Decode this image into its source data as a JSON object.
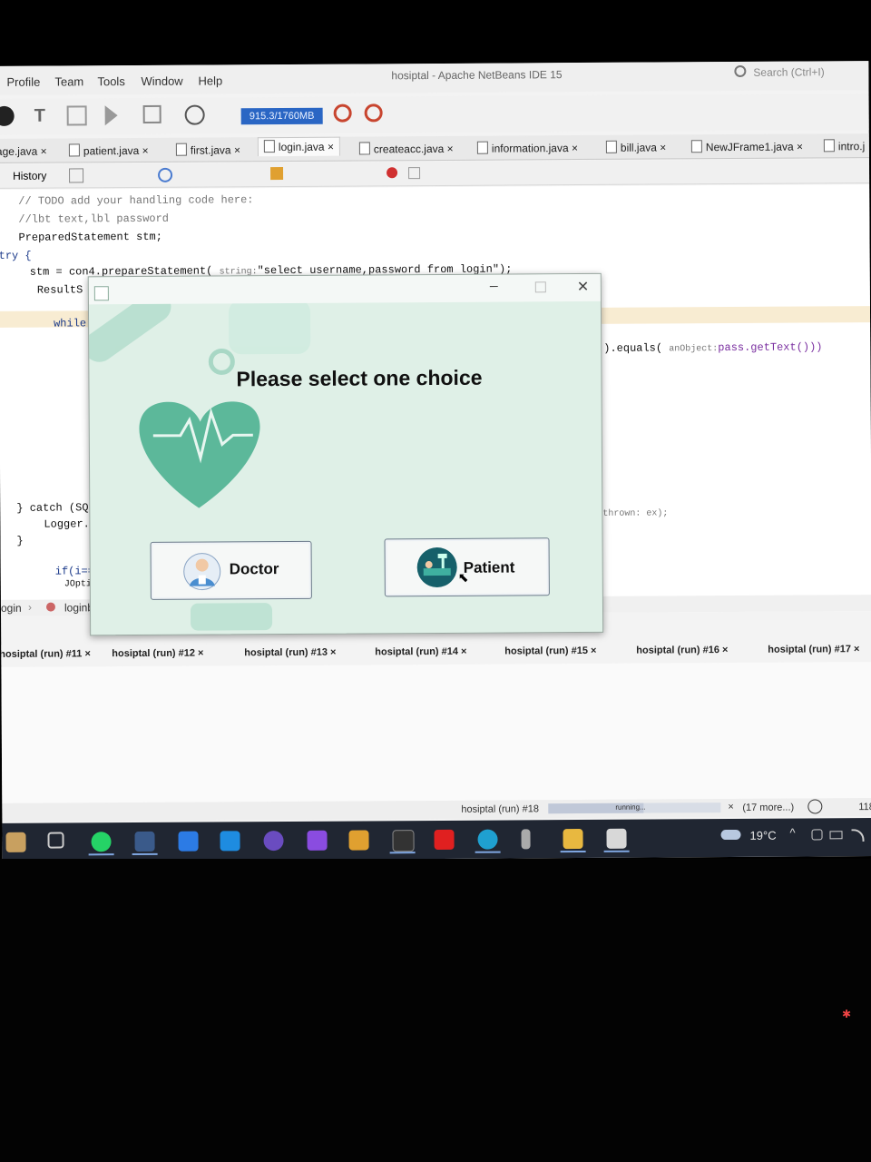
{
  "menu": [
    "Profile",
    "Team",
    "Tools",
    "Window",
    "Help"
  ],
  "window_title": "hosiptal - Apache NetBeans IDE 15",
  "search_placeholder": "Search (Ctrl+I)",
  "memory": "915.3/1760MB",
  "editor_tabs": [
    {
      "label": "age.java",
      "active": false
    },
    {
      "label": "patient.java",
      "active": false
    },
    {
      "label": "first.java",
      "active": false
    },
    {
      "label": "login.java",
      "active": true
    },
    {
      "label": "createacc.java",
      "active": false
    },
    {
      "label": "information.java",
      "active": false
    },
    {
      "label": "bill.java",
      "active": false
    },
    {
      "label": "NewJFrame1.java",
      "active": false
    },
    {
      "label": "intro.j",
      "active": false
    }
  ],
  "history_label": "History",
  "code": {
    "l1": "// TODO add your handling code here:",
    "l2": "//lbt text,lbl password",
    "l3": "PreparedStatement stm;",
    "l4": "try {",
    "l5a": "stm = con4.prepareStatement(",
    "l5hint": "string:",
    "l5b": "\"select username,password from login\");",
    "l6": "ResultS",
    "l7": "while",
    "l8a": ").equals(",
    "l8hint": "anObject:",
    "l8b": "pass.getText()))",
    "l9": "} catch (SQI",
    "l10": "Logger.g",
    "l10b": "thrown: ex);",
    "l11": "}",
    "l12": "if(i==1",
    "l13": "JOpti"
  },
  "breadcrumb": [
    "ogin",
    "loginbtn"
  ],
  "output_tabs": [
    "hosiptal (run) #11",
    "hosiptal (run) #12",
    "hosiptal (run) #13",
    "hosiptal (run) #14",
    "hosiptal (run) #15",
    "hosiptal (run) #16",
    "hosiptal (run) #17"
  ],
  "status": {
    "run": "hosiptal (run) #18",
    "progress_text": "running...",
    "more": "(17 more...)",
    "count": "118"
  },
  "taskbar": {
    "weather": "19°C"
  },
  "dialog": {
    "heading": "Please select one choice",
    "doctor_label": "Doctor",
    "patient_label": "Patient"
  },
  "colors": {
    "accent": "#2a66c4",
    "dialog_bg": "#dff0e7",
    "heart": "#5cb89a"
  }
}
